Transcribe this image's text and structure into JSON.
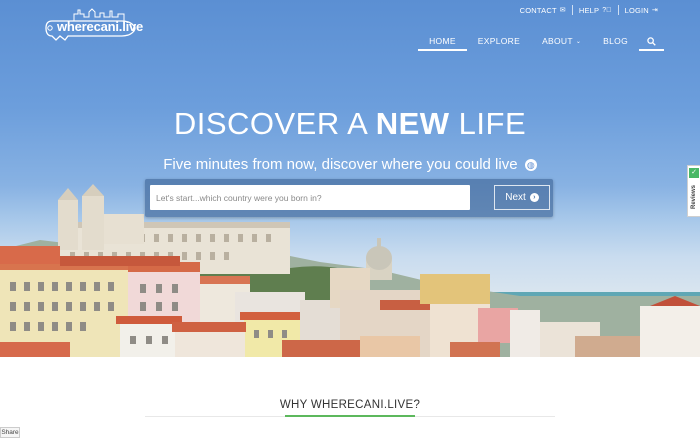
{
  "topbar": {
    "contact_label": "CONTACT",
    "help_label": "HELP",
    "login_label": "LOGIN",
    "contact_icon": "envelope-icon",
    "help_icon": "question-circle-icon",
    "login_icon": "sign-in-icon"
  },
  "logo": {
    "text": "wherecani.live"
  },
  "nav": {
    "items": [
      {
        "label": "HOME",
        "active": true
      },
      {
        "label": "EXPLORE",
        "active": false
      },
      {
        "label": "ABOUT",
        "active": false,
        "has_dropdown": true
      },
      {
        "label": "BLOG",
        "active": false
      }
    ],
    "search_icon": "search-icon"
  },
  "hero": {
    "headline_pre": "DISCOVER A ",
    "headline_bold": "NEW",
    "headline_post": " LIFE",
    "subhead": "Five minutes from now, discover where you could live",
    "search_placeholder": "Let's start...which country were you born in?",
    "next_label": "Next"
  },
  "reviews_tab": {
    "label": "Reviews"
  },
  "section": {
    "title": "WHY WHERECANI.LIVE?"
  },
  "share_label": "Share",
  "colors": {
    "accent_green": "#5cb85c",
    "sky_blue": "#5e8ed2"
  }
}
